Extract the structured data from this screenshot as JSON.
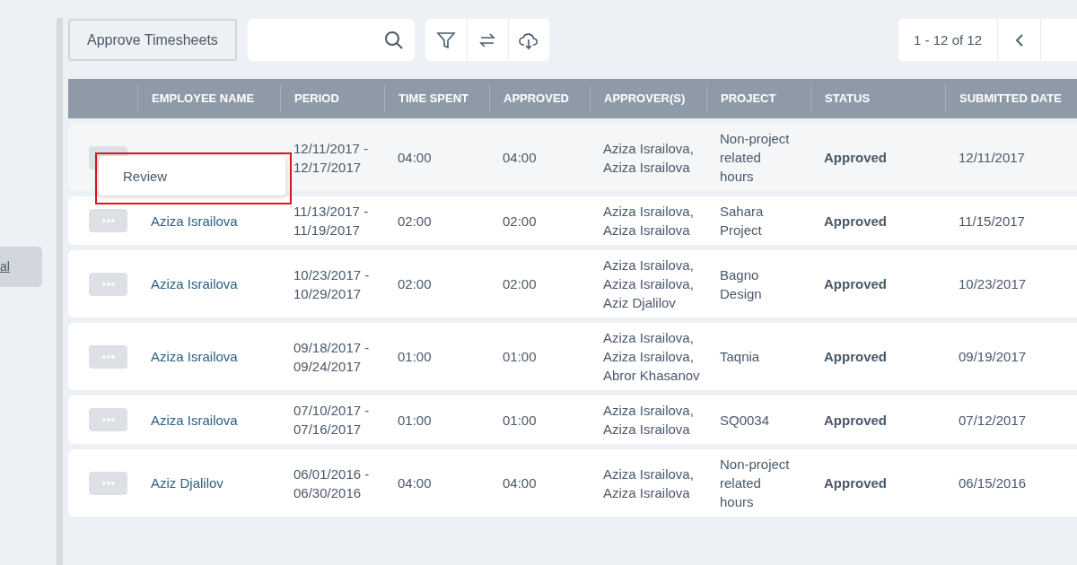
{
  "sidebar": {
    "items": [
      {
        "label": "al",
        "selected": true
      }
    ]
  },
  "toolbar": {
    "approve_button": "Approve Timesheets",
    "pagination": {
      "range": "1 - 12 of 12"
    }
  },
  "table": {
    "columns": [
      "EMPLOYEE NAME",
      "PERIOD",
      "TIME SPENT",
      "APPROVED",
      "APPROVER(S)",
      "PROJECT",
      "STATUS",
      "SUBMITTED DATE"
    ],
    "rows": [
      {
        "period": "12/11/2017 - 12/17/2017",
        "time_spent": "04:00",
        "approved": "04:00",
        "approvers": "Aziza Israilova, Aziza Israilova",
        "project": "Non-project related hours",
        "status": "Approved",
        "submitted": "12/11/2017",
        "menu_open": true
      },
      {
        "employee": "Aziza Israilova",
        "period": "11/13/2017 - 11/19/2017",
        "time_spent": "02:00",
        "approved": "02:00",
        "approvers": "Aziza Israilova, Aziza Israilova",
        "project": "Sahara Project",
        "status": "Approved",
        "submitted": "11/15/2017",
        "menu_open": false
      },
      {
        "employee": "Aziza Israilova",
        "period": "10/23/2017 - 10/29/2017",
        "time_spent": "02:00",
        "approved": "02:00",
        "approvers": "Aziza Israilova, Aziza Israilova, Aziz Djalilov",
        "project": "Bagno Design",
        "status": "Approved",
        "submitted": "10/23/2017",
        "menu_open": false
      },
      {
        "employee": "Aziza Israilova",
        "period": "09/18/2017 - 09/24/2017",
        "time_spent": "01:00",
        "approved": "01:00",
        "approvers": "Aziza Israilova, Aziza Israilova, Abror Khasanov",
        "project": "Taqnia",
        "status": "Approved",
        "submitted": "09/19/2017",
        "menu_open": false
      },
      {
        "employee": "Aziza Israilova",
        "period": "07/10/2017 - 07/16/2017",
        "time_spent": "01:00",
        "approved": "01:00",
        "approvers": "Aziza Israilova, Aziza Israilova",
        "project": "SQ0034",
        "status": "Approved",
        "submitted": "07/12/2017",
        "menu_open": false
      },
      {
        "employee": "Aziz Djalilov",
        "period": "06/01/2016 - 06/30/2016",
        "time_spent": "04:00",
        "approved": "04:00",
        "approvers": "Aziza Israilova, Aziza Israilova",
        "project": "Non-project related hours",
        "status": "Approved",
        "submitted": "06/15/2016",
        "menu_open": false
      }
    ]
  },
  "row_menu": {
    "items": [
      "Review"
    ],
    "highlighted": true
  }
}
